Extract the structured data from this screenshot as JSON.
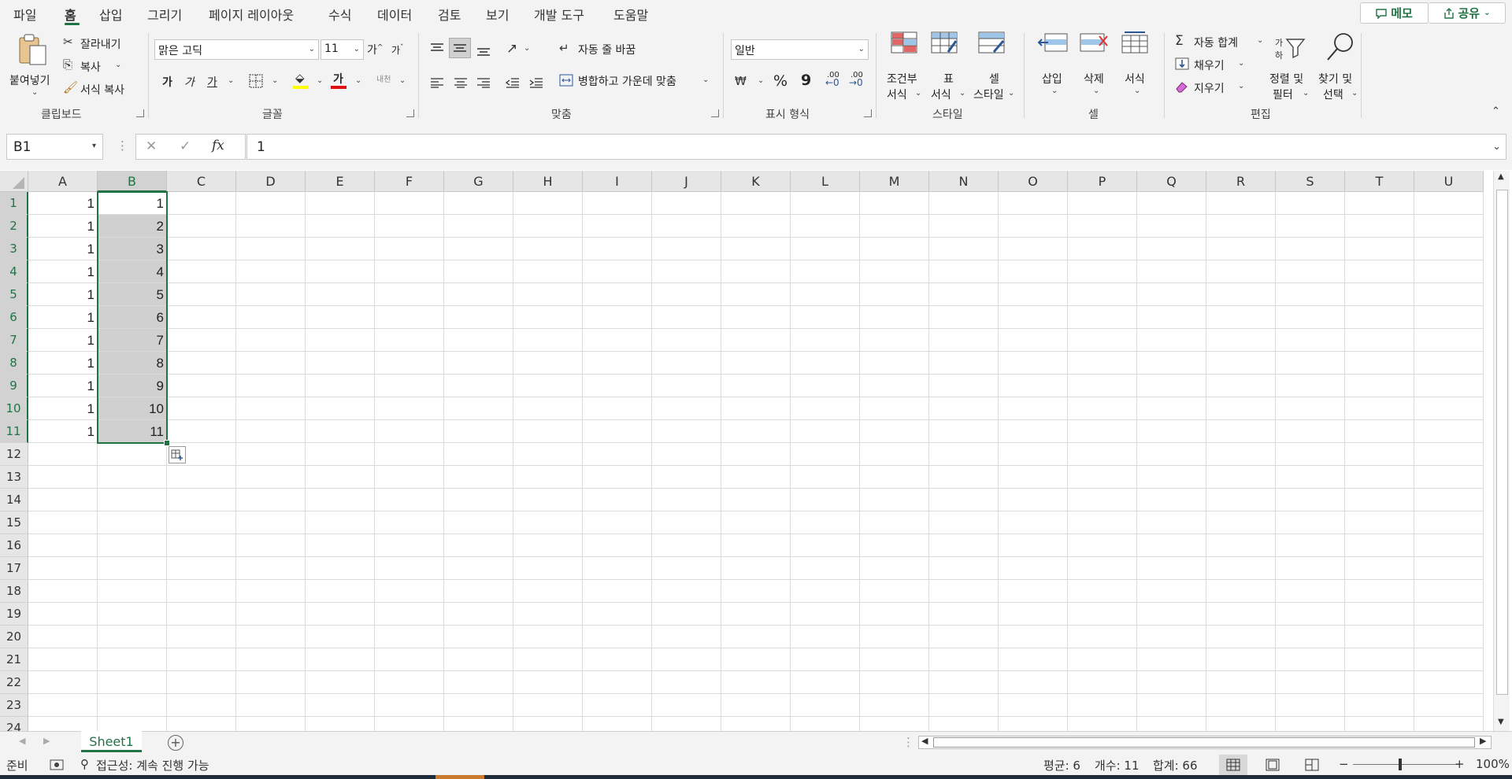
{
  "menu": {
    "tabs": [
      "파일",
      "홈",
      "삽입",
      "그리기",
      "페이지 레이아웃",
      "수식",
      "데이터",
      "검토",
      "보기",
      "개발 도구",
      "도움말"
    ],
    "active_tab": "홈",
    "memo_label": "메모",
    "share_label": "공유"
  },
  "ribbon": {
    "clipboard": {
      "paste": "붙여넣기",
      "cut": "잘라내기",
      "copy": "복사",
      "format_painter": "서식 복사",
      "group": "클립보드"
    },
    "font": {
      "font_name": "맑은 고딕",
      "font_size": "11",
      "grow": "가",
      "shrink": "가",
      "bold": "가",
      "italic": "가",
      "underline": "가",
      "font_color_glyph": "가",
      "phonetic": "내천",
      "group": "글꼴"
    },
    "alignment": {
      "wrap_text": "자동 줄 바꿈",
      "merge_center": "병합하고 가운데 맞춤",
      "group": "맞춤"
    },
    "number": {
      "format": "일반",
      "percent": "%",
      "comma": "9",
      "increase_decimal": ".00",
      "decrease_decimal": ".00",
      "group": "표시 형식"
    },
    "styles": {
      "conditional_line1": "조건부",
      "conditional_line2": "서식",
      "table_line1": "표",
      "table_line2": "서식",
      "cell_line1": "셀",
      "cell_line2": "스타일",
      "group": "스타일"
    },
    "cells": {
      "insert": "삽입",
      "delete": "삭제",
      "format": "서식",
      "group": "셀"
    },
    "editing": {
      "autosum": "자동 합계",
      "fill": "채우기",
      "clear": "지우기",
      "sort_line1": "정렬 및",
      "sort_line2": "필터",
      "find_line1": "찾기 및",
      "find_line2": "선택",
      "group": "편집"
    }
  },
  "formula_bar": {
    "name_box": "B1",
    "formula": "1"
  },
  "grid": {
    "columns": [
      "A",
      "B",
      "C",
      "D",
      "E",
      "F",
      "G",
      "H",
      "I",
      "J",
      "K",
      "L",
      "M",
      "N",
      "O",
      "P",
      "Q",
      "R",
      "S",
      "T",
      "U"
    ],
    "rows": [
      "1",
      "2",
      "3",
      "4",
      "5",
      "6",
      "7",
      "8",
      "9",
      "10",
      "11",
      "12",
      "13",
      "14",
      "15",
      "16",
      "17",
      "18",
      "19",
      "20",
      "21",
      "22",
      "23",
      "24"
    ],
    "col_a": [
      "1",
      "1",
      "1",
      "1",
      "1",
      "1",
      "1",
      "1",
      "1",
      "1",
      "1"
    ],
    "col_b": [
      "1",
      "2",
      "3",
      "4",
      "5",
      "6",
      "7",
      "8",
      "9",
      "10",
      "11"
    ]
  },
  "sheets": {
    "tabs": [
      "Sheet1"
    ]
  },
  "status": {
    "ready": "준비",
    "accessibility": "접근성: 계속 진행 가능",
    "average": "평균: 6",
    "count": "개수: 11",
    "sum": "합계: 66",
    "zoom": "100%"
  }
}
